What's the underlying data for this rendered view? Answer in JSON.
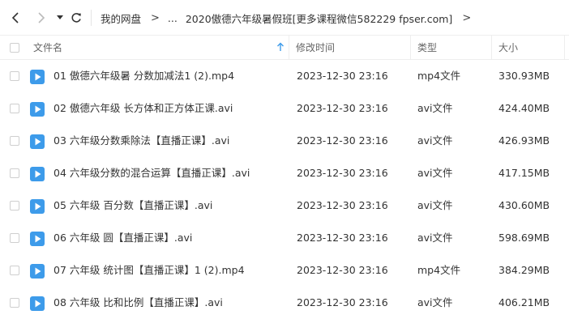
{
  "nav": {
    "back_icon": "chevron-left-icon",
    "forward_icon": "chevron-right-icon",
    "dropdown_icon": "caret-down-icon",
    "refresh_icon": "refresh-icon"
  },
  "breadcrumb": {
    "root": "我的网盘",
    "ellipsis": "...",
    "current": "2020傲德六年级暑假班[更多课程微信582229 fpser.com]",
    "separator": ">"
  },
  "columns": {
    "name": "文件名",
    "modified": "修改时间",
    "type": "类型",
    "size": "大小"
  },
  "colors": {
    "accent": "#3d9bea",
    "sort_arrow": "#3d9bea",
    "border": "#eeeeee"
  },
  "files": [
    {
      "name": "01 傲德六年级暑 分数加减法1 (2).mp4",
      "modified": "2023-12-30 23:16",
      "type": "mp4文件",
      "size": "330.93MB"
    },
    {
      "name": "02 傲德六年级 长方体和正方体正课.avi",
      "modified": "2023-12-30 23:16",
      "type": "avi文件",
      "size": "424.40MB"
    },
    {
      "name": "03 六年级分数乘除法【直播正课】.avi",
      "modified": "2023-12-30 23:16",
      "type": "avi文件",
      "size": "426.93MB"
    },
    {
      "name": "04 六年级分数的混合运算【直播正课】.avi",
      "modified": "2023-12-30 23:16",
      "type": "avi文件",
      "size": "417.15MB"
    },
    {
      "name": "05 六年级 百分数【直播正课】.avi",
      "modified": "2023-12-30 23:16",
      "type": "avi文件",
      "size": "430.60MB"
    },
    {
      "name": "06 六年级 圆【直播正课】.avi",
      "modified": "2023-12-30 23:16",
      "type": "avi文件",
      "size": "598.69MB"
    },
    {
      "name": "07 六年级 统计图【直播正课】1 (2).mp4",
      "modified": "2023-12-30 23:16",
      "type": "mp4文件",
      "size": "384.29MB"
    },
    {
      "name": "08 六年级 比和比例【直播正课】.avi",
      "modified": "2023-12-30 23:16",
      "type": "avi文件",
      "size": "406.21MB"
    }
  ]
}
